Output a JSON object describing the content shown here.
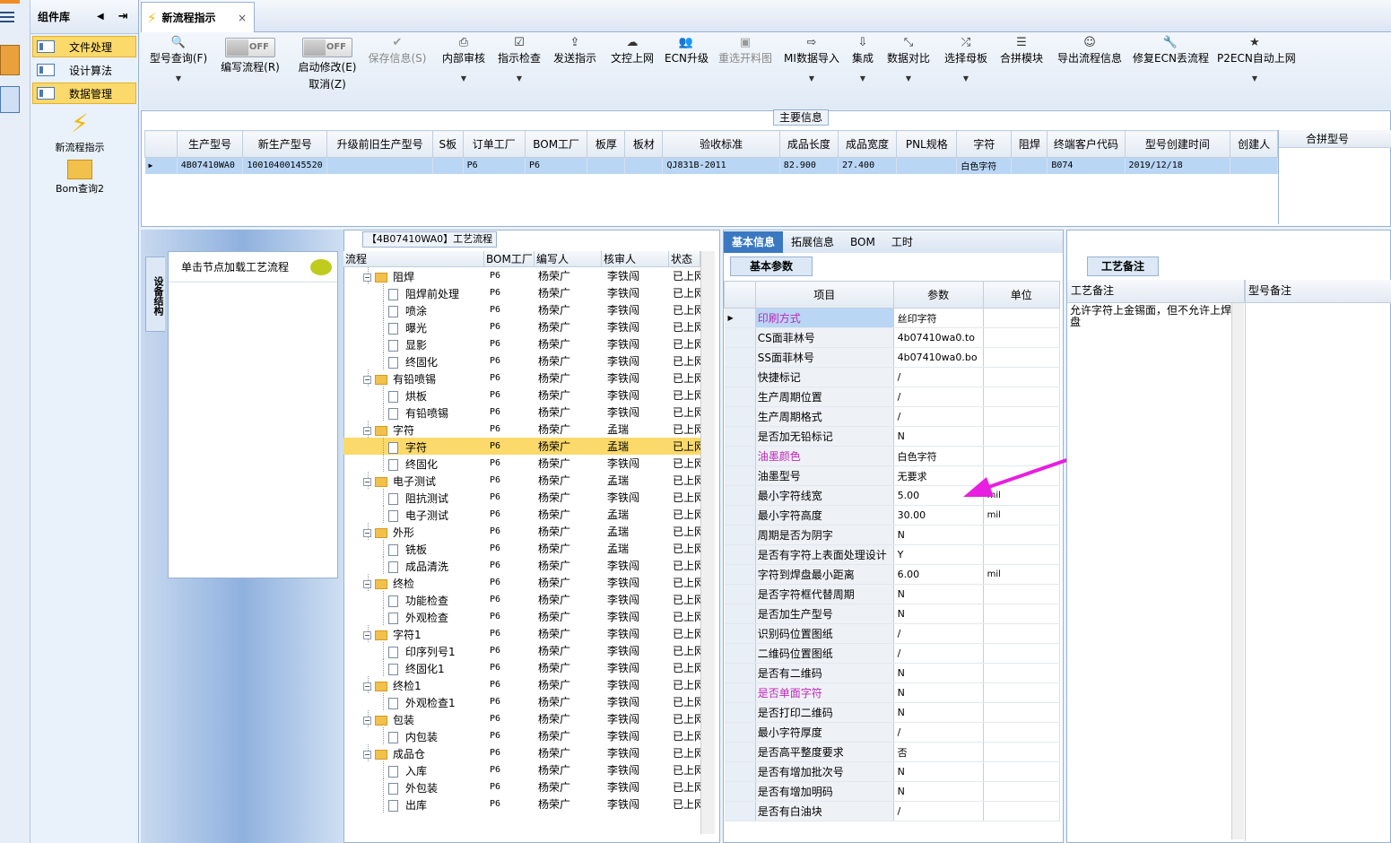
{
  "sidebar": {
    "title": "组件库",
    "items": [
      {
        "label": "文件处理",
        "active": true
      },
      {
        "label": "设计算法",
        "active": false
      },
      {
        "label": "数据管理",
        "active": true
      }
    ],
    "buttons": [
      {
        "label": "新流程指示",
        "icon": "lightning-icon"
      },
      {
        "label": "Bom查询2",
        "icon": "folder-open-icon"
      }
    ]
  },
  "tab": {
    "label": "新流程指示",
    "close": "×"
  },
  "toolbar": {
    "query": "型号查询(F)",
    "edit_flow": "编写流程(R)",
    "start_modify": "启动修改(E)",
    "cancel": "取消(Z)",
    "toggle_off": "OFF",
    "save": "保存信息(S)",
    "internal_review": "内部审核",
    "instruction_check": "指示检查",
    "send_instruction": "发送指示",
    "doc_upload": "文控上网",
    "ecn_upgrade": "ECN升级",
    "reselect_drawing": "重选开料图",
    "mi_import": "MI数据导入",
    "integrate": "集成",
    "data_compare": "数据对比",
    "select_mother": "选择母板",
    "merge_module": "合拼模块",
    "export_flow": "导出流程信息",
    "fix_ecn": "修复ECN丢流程",
    "p2ecn": "P2ECN自动上网"
  },
  "main_info": {
    "label": "主要信息",
    "columns": [
      "生产型号",
      "新生产型号",
      "升级前旧生产型号",
      "S板",
      "订单工厂",
      "BOM工厂",
      "板厚",
      "板材",
      "验收标准",
      "成品长度",
      "成品宽度",
      "PNL规格",
      "字符",
      "阻焊",
      "终端客户代码",
      "型号创建时间",
      "创建人"
    ],
    "row": [
      "4B07410WA0",
      "10010400145520",
      "",
      "",
      "P6",
      "P6",
      "",
      "",
      "QJ831B-2011",
      "82.900",
      "27.400",
      "",
      "白色字符",
      "",
      "B074",
      "2019/12/18",
      ""
    ],
    "merge_label": "合拼型号"
  },
  "left": {
    "vtab": "设备结构",
    "node_hint": "单击节点加载工艺流程"
  },
  "tree": {
    "label": "【4B07410WA0】工艺流程",
    "columns": [
      "流程",
      "BOM工厂",
      "编写人",
      "核审人",
      "状态"
    ],
    "rows": [
      {
        "name": "阻焊",
        "level": 0,
        "factory": "P6",
        "writer": "杨荣广",
        "reviewer": "李铁闯",
        "status": "已上网"
      },
      {
        "name": "阻焊前处理",
        "level": 1,
        "factory": "P6",
        "writer": "杨荣广",
        "reviewer": "李铁闯",
        "status": "已上网"
      },
      {
        "name": "喷涂",
        "level": 1,
        "factory": "P6",
        "writer": "杨荣广",
        "reviewer": "李铁闯",
        "status": "已上网"
      },
      {
        "name": "曝光",
        "level": 1,
        "factory": "P6",
        "writer": "杨荣广",
        "reviewer": "李铁闯",
        "status": "已上网"
      },
      {
        "name": "显影",
        "level": 1,
        "factory": "P6",
        "writer": "杨荣广",
        "reviewer": "李铁闯",
        "status": "已上网"
      },
      {
        "name": "终固化",
        "level": 1,
        "factory": "P6",
        "writer": "杨荣广",
        "reviewer": "李铁闯",
        "status": "已上网"
      },
      {
        "name": "有铅喷锡",
        "level": 0,
        "factory": "P6",
        "writer": "杨荣广",
        "reviewer": "李铁闯",
        "status": "已上网"
      },
      {
        "name": "烘板",
        "level": 1,
        "factory": "P6",
        "writer": "杨荣广",
        "reviewer": "李铁闯",
        "status": "已上网"
      },
      {
        "name": "有铅喷锡",
        "level": 1,
        "factory": "P6",
        "writer": "杨荣广",
        "reviewer": "李铁闯",
        "status": "已上网"
      },
      {
        "name": "字符",
        "level": 0,
        "factory": "P6",
        "writer": "杨荣广",
        "reviewer": "孟瑞",
        "status": "已上网"
      },
      {
        "name": "字符",
        "level": 1,
        "factory": "P6",
        "writer": "杨荣广",
        "reviewer": "孟瑞",
        "status": "已上网",
        "selected": true
      },
      {
        "name": "终固化",
        "level": 1,
        "factory": "P6",
        "writer": "杨荣广",
        "reviewer": "李铁闯",
        "status": "已上网"
      },
      {
        "name": "电子测试",
        "level": 0,
        "factory": "P6",
        "writer": "杨荣广",
        "reviewer": "孟瑞",
        "status": "已上网"
      },
      {
        "name": "阻抗测试",
        "level": 1,
        "factory": "P6",
        "writer": "杨荣广",
        "reviewer": "李铁闯",
        "status": "已上网"
      },
      {
        "name": "电子测试",
        "level": 1,
        "factory": "P6",
        "writer": "杨荣广",
        "reviewer": "孟瑞",
        "status": "已上网"
      },
      {
        "name": "外形",
        "level": 0,
        "factory": "P6",
        "writer": "杨荣广",
        "reviewer": "孟瑞",
        "status": "已上网"
      },
      {
        "name": "铣板",
        "level": 1,
        "factory": "P6",
        "writer": "杨荣广",
        "reviewer": "孟瑞",
        "status": "已上网"
      },
      {
        "name": "成品清洗",
        "level": 1,
        "factory": "P6",
        "writer": "杨荣广",
        "reviewer": "李铁闯",
        "status": "已上网"
      },
      {
        "name": "终检",
        "level": 0,
        "factory": "P6",
        "writer": "杨荣广",
        "reviewer": "李铁闯",
        "status": "已上网"
      },
      {
        "name": "功能检查",
        "level": 1,
        "factory": "P6",
        "writer": "杨荣广",
        "reviewer": "李铁闯",
        "status": "已上网"
      },
      {
        "name": "外观检查",
        "level": 1,
        "factory": "P6",
        "writer": "杨荣广",
        "reviewer": "李铁闯",
        "status": "已上网"
      },
      {
        "name": "字符1",
        "level": 0,
        "factory": "P6",
        "writer": "杨荣广",
        "reviewer": "李铁闯",
        "status": "已上网"
      },
      {
        "name": "印序列号1",
        "level": 1,
        "factory": "P6",
        "writer": "杨荣广",
        "reviewer": "李铁闯",
        "status": "已上网"
      },
      {
        "name": "终固化1",
        "level": 1,
        "factory": "P6",
        "writer": "杨荣广",
        "reviewer": "李铁闯",
        "status": "已上网"
      },
      {
        "name": "终检1",
        "level": 0,
        "factory": "P6",
        "writer": "杨荣广",
        "reviewer": "李铁闯",
        "status": "已上网"
      },
      {
        "name": "外观检查1",
        "level": 1,
        "factory": "P6",
        "writer": "杨荣广",
        "reviewer": "李铁闯",
        "status": "已上网"
      },
      {
        "name": "包装",
        "level": 0,
        "factory": "P6",
        "writer": "杨荣广",
        "reviewer": "李铁闯",
        "status": "已上网"
      },
      {
        "name": "内包装",
        "level": 1,
        "factory": "P6",
        "writer": "杨荣广",
        "reviewer": "李铁闯",
        "status": "已上网"
      },
      {
        "name": "成品仓",
        "level": 0,
        "factory": "P6",
        "writer": "杨荣广",
        "reviewer": "李铁闯",
        "status": "已上网"
      },
      {
        "name": "入库",
        "level": 1,
        "factory": "P6",
        "writer": "杨荣广",
        "reviewer": "李铁闯",
        "status": "已上网"
      },
      {
        "name": "外包装",
        "level": 1,
        "factory": "P6",
        "writer": "杨荣广",
        "reviewer": "李铁闯",
        "status": "已上网"
      },
      {
        "name": "出库",
        "level": 1,
        "factory": "P6",
        "writer": "杨荣广",
        "reviewer": "李铁闯",
        "status": "已上网"
      }
    ]
  },
  "detail": {
    "tabs": [
      "基本信息",
      "拓展信息",
      "BOM",
      "工时"
    ],
    "subtab": "基本参数",
    "columns": [
      "项目",
      "参数",
      "单位"
    ],
    "params": [
      {
        "item": "印刷方式",
        "value": "丝印字符",
        "unit": "",
        "magenta": true,
        "selected": true
      },
      {
        "item": "CS面菲林号",
        "value": "4b07410wa0.to",
        "unit": ""
      },
      {
        "item": "SS面菲林号",
        "value": "4b07410wa0.bo",
        "unit": ""
      },
      {
        "item": "快捷标记",
        "value": "/",
        "unit": ""
      },
      {
        "item": "生产周期位置",
        "value": "/",
        "unit": ""
      },
      {
        "item": "生产周期格式",
        "value": "/",
        "unit": ""
      },
      {
        "item": "是否加无铅标记",
        "value": "N",
        "unit": ""
      },
      {
        "item": "油墨颜色",
        "value": "白色字符",
        "unit": "",
        "magenta": true
      },
      {
        "item": "油墨型号",
        "value": "无要求",
        "unit": ""
      },
      {
        "item": "最小字符线宽",
        "value": "5.00",
        "unit": "mil"
      },
      {
        "item": "最小字符高度",
        "value": "30.00",
        "unit": "mil"
      },
      {
        "item": "周期是否为阴字",
        "value": "N",
        "unit": ""
      },
      {
        "item": "是否有字符上表面处理设计",
        "value": "Y",
        "unit": ""
      },
      {
        "item": "字符到焊盘最小距离",
        "value": "6.00",
        "unit": "mil"
      },
      {
        "item": "是否字符框代替周期",
        "value": "N",
        "unit": ""
      },
      {
        "item": "是否加生产型号",
        "value": "N",
        "unit": ""
      },
      {
        "item": "识别码位置图纸",
        "value": "/",
        "unit": ""
      },
      {
        "item": "二维码位置图纸",
        "value": "/",
        "unit": ""
      },
      {
        "item": "是否有二维码",
        "value": "N",
        "unit": ""
      },
      {
        "item": "是否单面字符",
        "value": "N",
        "unit": "",
        "magenta": true
      },
      {
        "item": "是否打印二维码",
        "value": "N",
        "unit": ""
      },
      {
        "item": "最小字符厚度",
        "value": "/",
        "unit": ""
      },
      {
        "item": "是否高平整度要求",
        "value": "否",
        "unit": ""
      },
      {
        "item": "是否有增加批次号",
        "value": "N",
        "unit": ""
      },
      {
        "item": "是否有增加明码",
        "value": "N",
        "unit": ""
      },
      {
        "item": "是否有白油块",
        "value": "/",
        "unit": ""
      }
    ]
  },
  "notes": {
    "tab": "工艺备注",
    "col1": "工艺备注",
    "col2": "型号备注",
    "process_note": "允许字符上金锡面，但不允许上焊盘"
  },
  "colors": {
    "accent": "#3a78c2",
    "highlight": "#fbd96a",
    "arrow": "#e81ee0",
    "magenta_text": "#c026b8"
  }
}
